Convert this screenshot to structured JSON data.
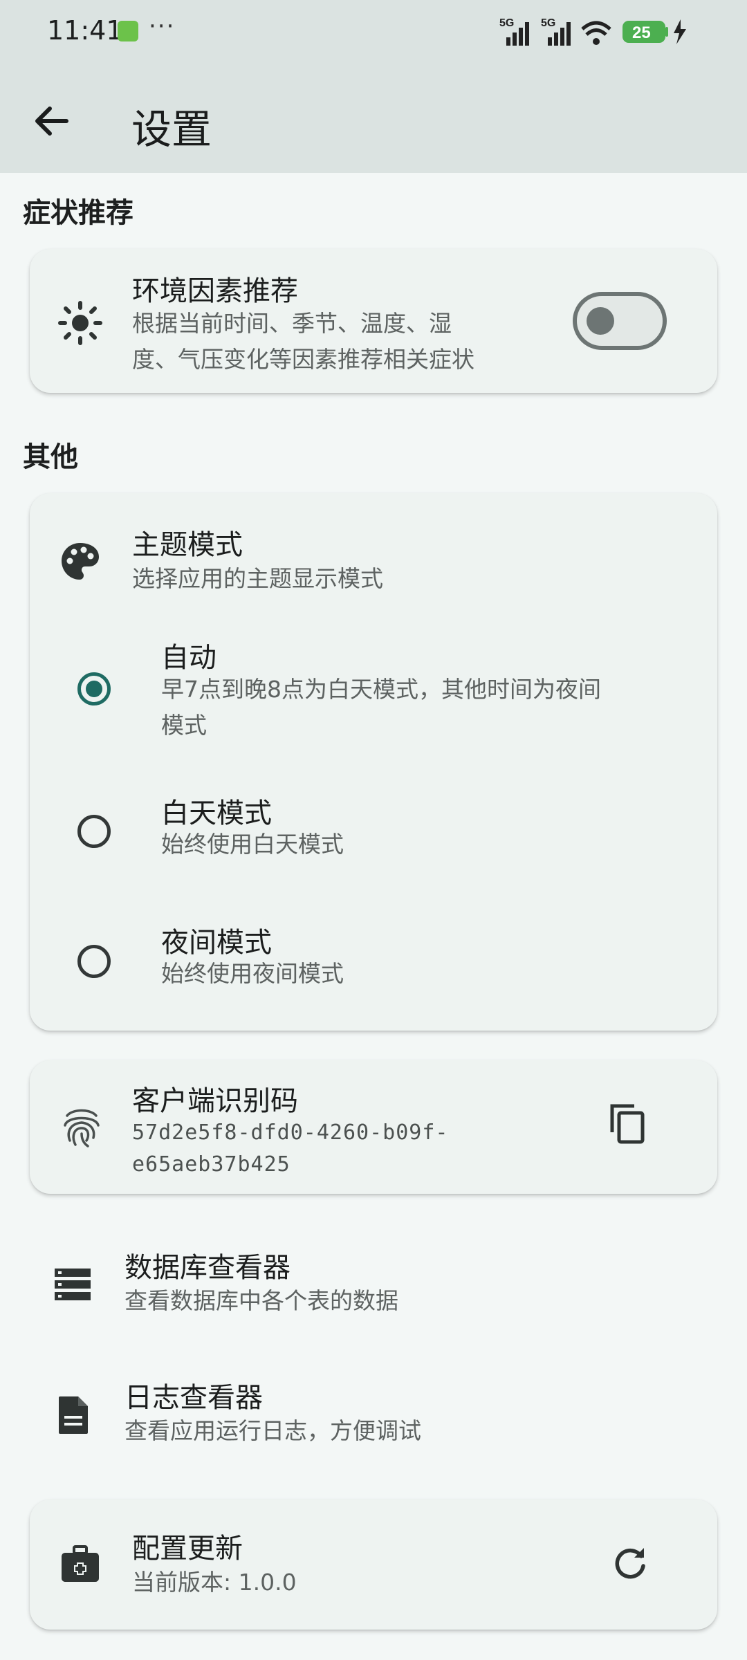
{
  "status_bar": {
    "time": "11:41",
    "dots": "···",
    "network1": "5G",
    "network2": "5G",
    "battery": "25"
  },
  "app_bar": {
    "title": "设置"
  },
  "sections": {
    "symptom": "症状推荐",
    "other": "其他"
  },
  "env_recommend": {
    "title": "环境因素推荐",
    "subtitle_line1": "根据当前时间、季节、温度、湿",
    "subtitle_line2": "度、气压变化等因素推荐相关症状",
    "enabled": false
  },
  "theme": {
    "title": "主题模式",
    "subtitle": "选择应用的主题显示模式",
    "options": [
      {
        "label": "自动",
        "desc_line1": "早7点到晚8点为白天模式，其他时间为夜间",
        "desc_line2": "模式",
        "selected": true
      },
      {
        "label": "白天模式",
        "desc_line1": "始终使用白天模式",
        "selected": false
      },
      {
        "label": "夜间模式",
        "desc_line1": "始终使用夜间模式",
        "selected": false
      }
    ]
  },
  "client_id": {
    "title": "客户端识别码",
    "value_line1": "57d2e5f8-dfd0-4260-b09f-",
    "value_line2": "e65aeb37b425"
  },
  "db_viewer": {
    "title": "数据库查看器",
    "subtitle": "查看数据库中各个表的数据"
  },
  "log_viewer": {
    "title": "日志查看器",
    "subtitle": "查看应用运行日志，方便调试"
  },
  "config_update": {
    "title": "配置更新",
    "subtitle": "当前版本: 1.0.0"
  },
  "colors": {
    "accent": "#1f6b63",
    "background": "#f3f7f6",
    "app_bar": "#dbe3e1",
    "card": "#eef3f1"
  }
}
